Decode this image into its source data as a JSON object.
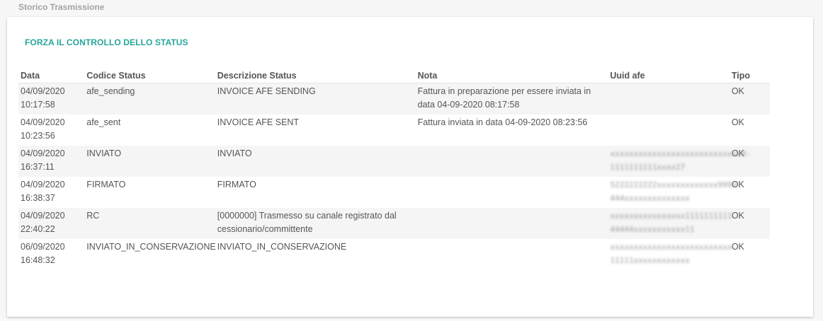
{
  "section": {
    "title": "Storico Trasmissione"
  },
  "actions": {
    "force_check_label": "FORZA IL CONTROLLO DELLO STATUS"
  },
  "table": {
    "headers": {
      "data": "Data",
      "codice": "Codice Status",
      "descrizione": "Descrizione Status",
      "nota": "Nota",
      "uuid": "Uuid afe",
      "tipo": "Tipo"
    },
    "rows": [
      {
        "date": "04/09/2020",
        "time": "10:17:58",
        "codice": "afe_sending",
        "descrizione": "INVOICE AFE SENDING",
        "nota": "Fattura in preparazione per essere inviata in data 04-09-2020 08:17:58",
        "uuid_line1": "",
        "uuid_line2": "",
        "tipo": "OK"
      },
      {
        "date": "04/09/2020",
        "time": "10:23:56",
        "codice": "afe_sent",
        "descrizione": "INVOICE AFE SENT",
        "nota": "Fattura inviata in data 04-09-2020 08:23:56",
        "uuid_line1": "",
        "uuid_line2": "",
        "tipo": "OK"
      },
      {
        "date": "04/09/2020",
        "time": "16:37:11",
        "codice": "INVIATO",
        "descrizione": "INVIATO",
        "nota": "",
        "uuid_line1": "xxxxxxxxxxxxxxxxxxxxxxxxxxxx0-",
        "uuid_line2": "1111111111xxxx27",
        "tipo": "OK"
      },
      {
        "date": "04/09/2020",
        "time": "16:38:37",
        "codice": "FIRMATO",
        "descrizione": "FIRMATO",
        "nota": "",
        "uuid_line1": "5222222222xxxxxxxxxxxxx9999-",
        "uuid_line2": "444xxxxxxxxxxxxxx",
        "tipo": "OK"
      },
      {
        "date": "04/09/2020",
        "time": "22:40:22",
        "codice": "RC",
        "descrizione": "[0000000] Trasmesso su canale registrato dal cessionario/committente",
        "nota": "",
        "uuid_line1": "xxxxxxxxxxxxxxxx1111111111-",
        "uuid_line2": "44444xxxxxxxxxxx11",
        "tipo": "OK"
      },
      {
        "date": "06/09/2020",
        "time": "16:48:32",
        "codice": "INVIATO_IN_CONSERVAZIONE",
        "descrizione": "INVIATO_IN_CONSERVAZIONE",
        "nota": "",
        "uuid_line1": "xxxxxxxxxxxxxxxxxxxxxxxxxx-",
        "uuid_line2": "11111xxxxxxxxxxxx",
        "tipo": "OK"
      }
    ]
  },
  "colors": {
    "accent": "#26a69a",
    "row_stripe": "#f5f5f5",
    "title": "#a3a3a3"
  }
}
